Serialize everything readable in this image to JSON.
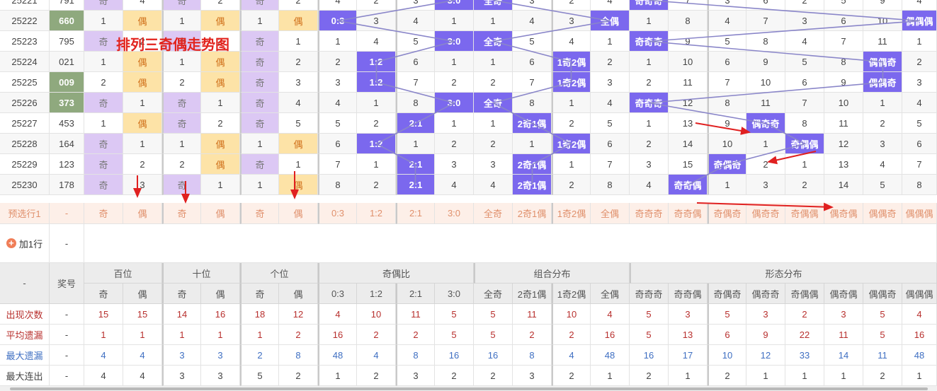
{
  "title_overlay": "排列三奇偶走势图",
  "rows": [
    {
      "issue": "25221",
      "num": "791",
      "green": false,
      "cells": [
        "奇",
        "4",
        "奇",
        "2",
        "奇",
        "2",
        "4",
        "2",
        "3",
        "3:0",
        "全奇",
        "3",
        "2",
        "4",
        "奇奇奇",
        "7",
        "3",
        "6",
        "2",
        "5",
        "9",
        "4"
      ]
    },
    {
      "issue": "25222",
      "num": "660",
      "green": true,
      "cells": [
        "1",
        "偶",
        "1",
        "偶",
        "1",
        "偶",
        "0:3",
        "3",
        "4",
        "1",
        "1",
        "4",
        "3",
        "全偶",
        "1",
        "8",
        "4",
        "7",
        "3",
        "6",
        "10",
        "偶偶偶"
      ]
    },
    {
      "issue": "25223",
      "num": "795",
      "green": false,
      "cells": [
        "奇",
        "2",
        "奇",
        "2",
        "奇",
        "1",
        "1",
        "4",
        "5",
        "3:0",
        "全奇",
        "5",
        "4",
        "1",
        "奇奇奇",
        "9",
        "5",
        "8",
        "4",
        "7",
        "11",
        "1"
      ]
    },
    {
      "issue": "25224",
      "num": "021",
      "green": false,
      "cells": [
        "1",
        "偶",
        "1",
        "偶",
        "奇",
        "2",
        "2",
        "1:2",
        "6",
        "1",
        "1",
        "6",
        "1奇2偶",
        "2",
        "1",
        "10",
        "6",
        "9",
        "5",
        "8",
        "偶偶奇",
        "2"
      ]
    },
    {
      "issue": "25225",
      "num": "009",
      "green": true,
      "cells": [
        "2",
        "偶",
        "2",
        "偶",
        "奇",
        "3",
        "3",
        "1:2",
        "7",
        "2",
        "2",
        "7",
        "1奇2偶",
        "3",
        "2",
        "11",
        "7",
        "10",
        "6",
        "9",
        "偶偶奇",
        "3"
      ]
    },
    {
      "issue": "25226",
      "num": "373",
      "green": true,
      "cells": [
        "奇",
        "1",
        "奇",
        "1",
        "奇",
        "4",
        "4",
        "1",
        "8",
        "3:0",
        "全奇",
        "8",
        "1",
        "4",
        "奇奇奇",
        "12",
        "8",
        "11",
        "7",
        "10",
        "1",
        "4"
      ]
    },
    {
      "issue": "25227",
      "num": "453",
      "green": false,
      "cells": [
        "1",
        "偶",
        "奇",
        "2",
        "奇",
        "5",
        "5",
        "2",
        "2:1",
        "1",
        "1",
        "2奇1偶",
        "2",
        "5",
        "1",
        "13",
        "9",
        "偶奇奇",
        "8",
        "11",
        "2",
        "5"
      ]
    },
    {
      "issue": "25228",
      "num": "164",
      "green": false,
      "cells": [
        "奇",
        "1",
        "1",
        "偶",
        "1",
        "偶",
        "6",
        "1:2",
        "1",
        "2",
        "2",
        "1",
        "1奇2偶",
        "6",
        "2",
        "14",
        "10",
        "1",
        "奇偶偶",
        "12",
        "3",
        "6"
      ]
    },
    {
      "issue": "25229",
      "num": "123",
      "green": false,
      "cells": [
        "奇",
        "2",
        "2",
        "偶",
        "奇",
        "1",
        "7",
        "1",
        "2:1",
        "3",
        "3",
        "2奇1偶",
        "1",
        "7",
        "3",
        "15",
        "奇偶奇",
        "2",
        "1",
        "13",
        "4",
        "7"
      ]
    },
    {
      "issue": "25230",
      "num": "178",
      "green": false,
      "cells": [
        "奇",
        "3",
        "奇",
        "1",
        "1",
        "偶",
        "8",
        "2",
        "2:1",
        "4",
        "4",
        "2奇1偶",
        "2",
        "8",
        "4",
        "奇奇偶",
        "1",
        "3",
        "2",
        "14",
        "5",
        "8"
      ]
    }
  ],
  "preselect": {
    "label": "预选行1",
    "num": "-",
    "cells": [
      "奇",
      "偶",
      "奇",
      "偶",
      "奇",
      "偶",
      "0:3",
      "1:2",
      "2:1",
      "3:0",
      "全奇",
      "2奇1偶",
      "1奇2偶",
      "全偶",
      "奇奇奇",
      "奇奇偶",
      "奇偶奇",
      "偶奇奇",
      "奇偶偶",
      "偶奇偶",
      "偶偶奇",
      "偶偶偶"
    ]
  },
  "add_row": {
    "label": "加1行",
    "num": "-"
  },
  "header": {
    "issue_label": "-",
    "num_label": "奖号",
    "groups": [
      {
        "label": "百位",
        "span": 2
      },
      {
        "label": "十位",
        "span": 2
      },
      {
        "label": "个位",
        "span": 2
      },
      {
        "label": "奇偶比",
        "span": 4
      },
      {
        "label": "组合分布",
        "span": 4
      },
      {
        "label": "形态分布",
        "span": 8
      }
    ],
    "subs": [
      "奇",
      "偶",
      "奇",
      "偶",
      "奇",
      "偶",
      "0:3",
      "1:2",
      "2:1",
      "3:0",
      "全奇",
      "2奇1偶",
      "1奇2偶",
      "全偶",
      "奇奇奇",
      "奇奇偶",
      "奇偶奇",
      "偶奇奇",
      "奇偶偶",
      "偶奇偶",
      "偶偶奇",
      "偶偶偶"
    ]
  },
  "stats": [
    {
      "label": "出现次数",
      "num": "-",
      "color": "red",
      "values": [
        "15",
        "15",
        "14",
        "16",
        "18",
        "12",
        "4",
        "10",
        "11",
        "5",
        "5",
        "11",
        "10",
        "4",
        "5",
        "3",
        "5",
        "3",
        "2",
        "3",
        "5",
        "4"
      ]
    },
    {
      "label": "平均遗漏",
      "num": "-",
      "color": "red",
      "values": [
        "1",
        "1",
        "1",
        "1",
        "1",
        "2",
        "16",
        "2",
        "2",
        "5",
        "5",
        "2",
        "2",
        "16",
        "5",
        "13",
        "6",
        "9",
        "22",
        "11",
        "5",
        "16"
      ]
    },
    {
      "label": "最大遗漏",
      "num": "-",
      "color": "blue",
      "values": [
        "4",
        "4",
        "3",
        "3",
        "2",
        "8",
        "48",
        "4",
        "8",
        "16",
        "16",
        "8",
        "4",
        "48",
        "16",
        "17",
        "10",
        "12",
        "33",
        "14",
        "11",
        "48"
      ]
    },
    {
      "label": "最大连出",
      "num": "-",
      "color": "dark",
      "values": [
        "4",
        "4",
        "3",
        "3",
        "5",
        "2",
        "1",
        "2",
        "3",
        "2",
        "2",
        "3",
        "2",
        "1",
        "2",
        "1",
        "2",
        "1",
        "1",
        "1",
        "2",
        "1"
      ]
    }
  ],
  "colors": {
    "odd_bg": "#dcc8f4",
    "even_bg": "#fde3a7",
    "hit_bg": "#7b68ee",
    "green_num": "#8fa97e",
    "preselect_bg": "#fdefe8",
    "line": "#8a86c9",
    "arrow": "#e02020"
  }
}
